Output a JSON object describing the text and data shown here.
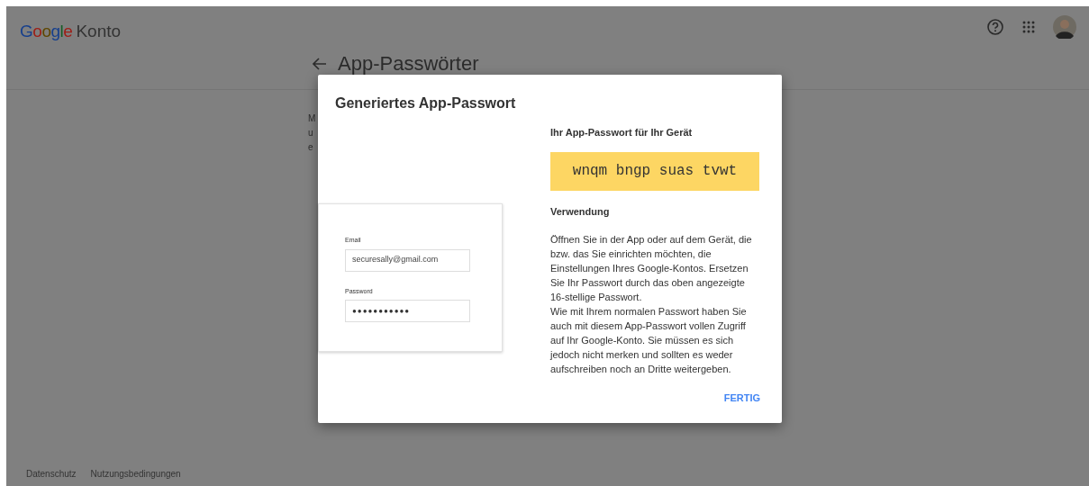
{
  "header": {
    "logo": "Google",
    "product": "Konto"
  },
  "page": {
    "title": "App-Passwörter",
    "fragments": [
      "M",
      "u",
      "e"
    ]
  },
  "dialog": {
    "title": "Generiertes App-Passwort",
    "illustration": {
      "email_label": "Email",
      "email_value": "securesally@gmail.com",
      "password_label": "Password",
      "password_value": "●●●●●●●●●●●"
    },
    "password_heading": "Ihr App-Passwort für Ihr Gerät",
    "password": "wnqm bngp suas tvwt",
    "usage_heading": "Verwendung",
    "usage_paragraphs": [
      "Öffnen Sie in der App oder auf dem Gerät, die bzw. das Sie einrichten möchten, die Einstellungen Ihres Google-Kontos. Ersetzen Sie Ihr Passwort durch das oben angezeigte 16-stellige Passwort.",
      "Wie mit Ihrem normalen Passwort haben Sie auch mit diesem App-Passwort vollen Zugriff auf Ihr Google-Konto. Sie müssen es sich jedoch nicht merken und sollten es weder aufschreiben noch an Dritte weitergeben."
    ],
    "button": "FERTIG"
  },
  "footer": {
    "links": [
      "Datenschutz",
      "Nutzungsbedingungen"
    ]
  }
}
